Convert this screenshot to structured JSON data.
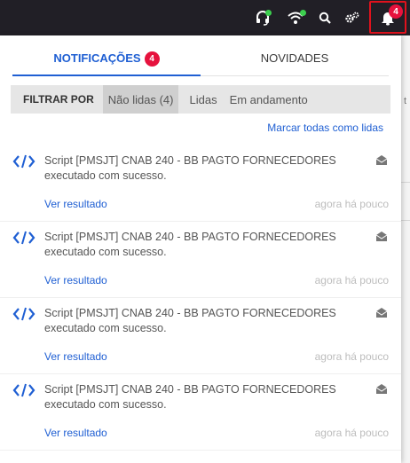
{
  "topbar": {
    "icons": [
      "headset-icon",
      "wifi-icon",
      "search-icon",
      "settings-icon",
      "bell-icon"
    ],
    "bell_badge": "4",
    "status_dot_color": "#3ccf4e"
  },
  "tabs": [
    {
      "label": "NOTIFICAÇÕES",
      "badge": "4"
    },
    {
      "label": "NOVIDADES"
    }
  ],
  "filter": {
    "label": "FILTRAR POR",
    "options": [
      "Não lidas (4)",
      "Lidas",
      "Em andamento"
    ],
    "selected": "Não lidas (4)"
  },
  "mark_all_label": "Marcar todas como lidas",
  "notifications": [
    {
      "text": "Script [PMSJT] CNAB 240 - BB PAGTO FORNECEDORES executado com sucesso.",
      "link": "Ver resultado",
      "time": "agora há pouco"
    },
    {
      "text": "Script [PMSJT] CNAB 240 - BB PAGTO FORNECEDORES executado com sucesso.",
      "link": "Ver resultado",
      "time": "agora há pouco"
    },
    {
      "text": "Script [PMSJT] CNAB 240 - BB PAGTO FORNECEDORES executado com sucesso.",
      "link": "Ver resultado",
      "time": "agora há pouco"
    },
    {
      "text": "Script [PMSJT] CNAB 240 - BB PAGTO FORNECEDORES executado com sucesso.",
      "link": "Ver resultado",
      "time": "agora há pouco"
    }
  ],
  "background_fragment": {
    "text": "t"
  },
  "colors": {
    "accent": "#1f5fd3",
    "badge": "#e6123d",
    "topbar": "#211f26",
    "highlight": "#e0121d"
  }
}
